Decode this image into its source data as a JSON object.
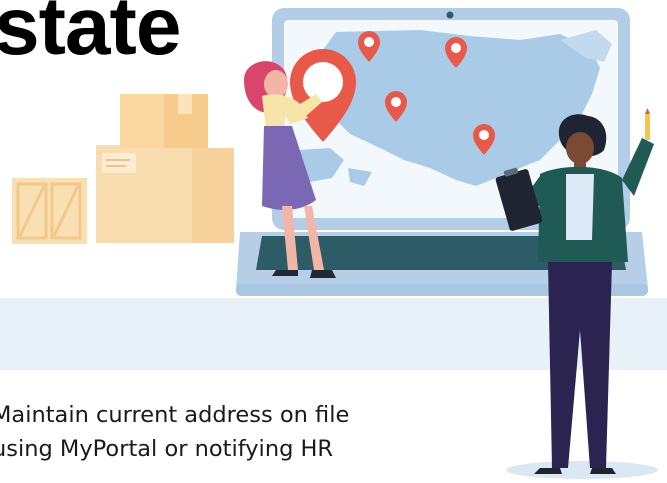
{
  "slide": {
    "title_fragment": "state",
    "caption_lines": [
      "Maintain current address on file",
      "using MyPortal or notifying HR"
    ]
  },
  "colors": {
    "title": "#000000",
    "pin": "#e8594a",
    "laptop_frame": "#a9c6e3",
    "laptop_base": "#2e5c66",
    "map_land": "#a9cbe8",
    "box": "#f7d7a4",
    "floor": "#e8f0f8",
    "woman_skirt": "#7b68b5",
    "woman_hair": "#d9466b",
    "man_suit": "#1f5a55",
    "man_pants": "#2b2450"
  },
  "illustration": {
    "icons": [
      "laptop-icon",
      "map-pin-icon",
      "cardboard-box-icon",
      "woman-figure-icon",
      "man-figure-icon",
      "clipboard-icon",
      "pencil-icon"
    ]
  }
}
